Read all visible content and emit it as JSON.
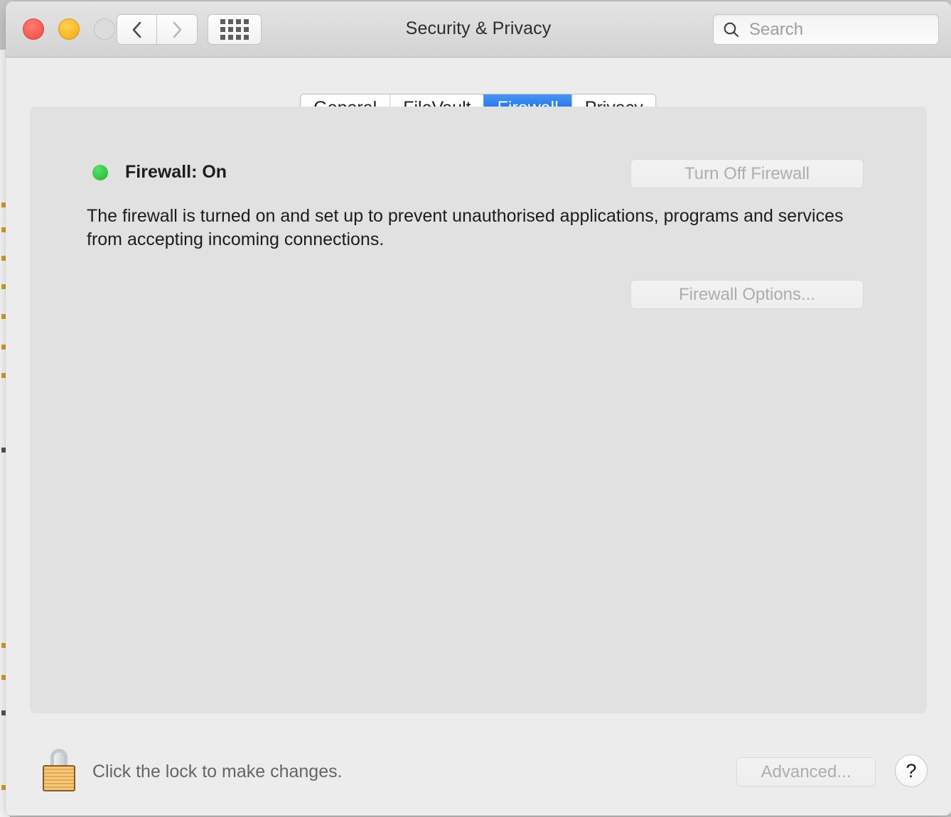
{
  "window": {
    "title": "Security & Privacy",
    "traffic_lights": [
      {
        "name": "close",
        "color": "#f25a50"
      },
      {
        "name": "minimize",
        "color": "#f9b421"
      },
      {
        "name": "zoom",
        "color": "#dcdcdc"
      }
    ],
    "nav": {
      "back_icon": "chevron-left-icon",
      "forward_icon": "chevron-right-icon",
      "grid_icon": "show-all-grid-icon"
    }
  },
  "search": {
    "icon": "search-icon",
    "placeholder": "Search",
    "value": ""
  },
  "tabs": [
    {
      "label": "General",
      "selected": false
    },
    {
      "label": "FileVault",
      "selected": false
    },
    {
      "label": "Firewall",
      "selected": true
    },
    {
      "label": "Privacy",
      "selected": false
    }
  ],
  "firewall": {
    "status_dot_color": "#2ec03f",
    "status_label": "Firewall: On",
    "description": "The firewall is turned on and set up to prevent unauthorised applications, programs and services from accepting incoming connections.",
    "turn_off_button": "Turn Off Firewall",
    "options_button": "Firewall Options...",
    "buttons_enabled": false
  },
  "bottom_bar": {
    "lock_icon": "closed-padlock-icon",
    "lock_text": "Click the lock to make changes.",
    "advanced_button": "Advanced...",
    "help_button": "?"
  },
  "colors": {
    "accent_blue": "#2277ec",
    "window_bg": "#ececec",
    "panel_bg": "#e1e1e1",
    "status_green": "#2ec03f"
  }
}
